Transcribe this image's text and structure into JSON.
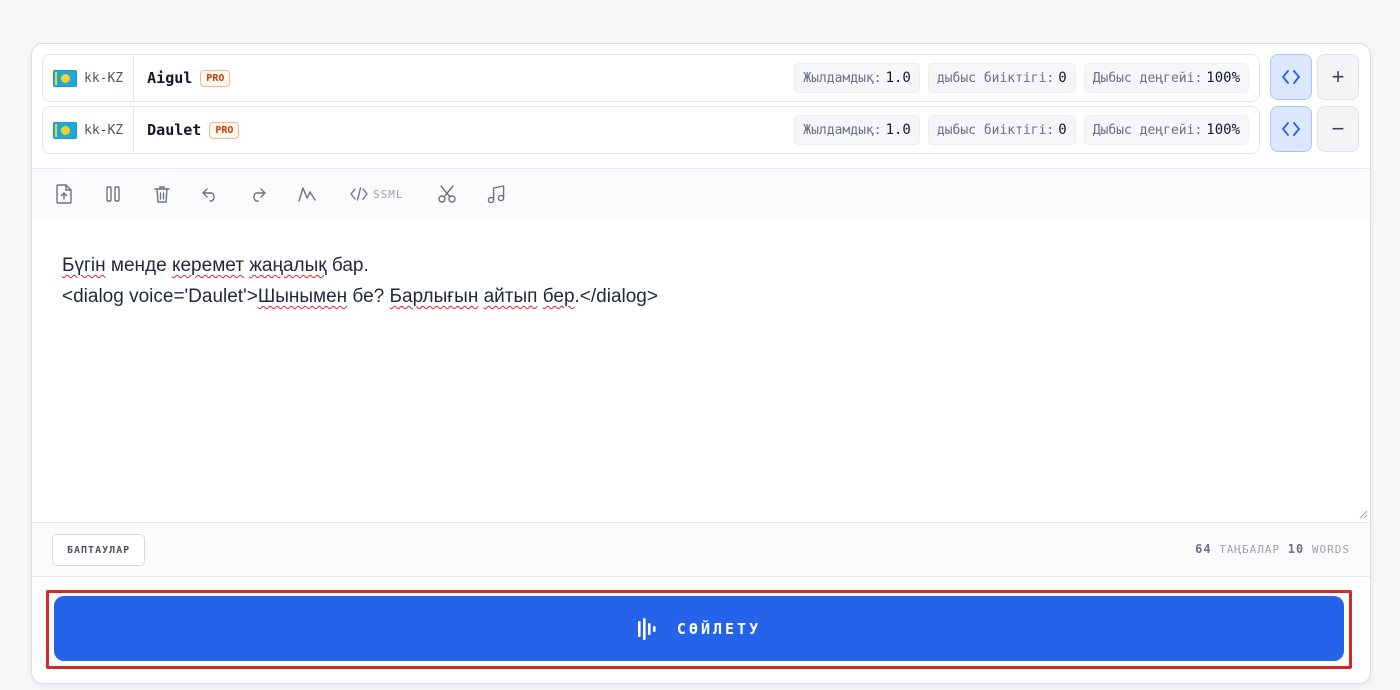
{
  "voices": [
    {
      "lang_code": "kk-KZ",
      "name": "Aigul",
      "badge": "PRO",
      "speed_label": "Жылдамдық:",
      "speed_value": "1.0",
      "pitch_label": "дыбыс биіктігі:",
      "pitch_value": "0",
      "volume_label": "Дыбыс деңгейі:",
      "volume_value": "100%",
      "action_symbol": "+"
    },
    {
      "lang_code": "kk-KZ",
      "name": "Daulet",
      "badge": "PRO",
      "speed_label": "Жылдамдық:",
      "speed_value": "1.0",
      "pitch_label": "дыбыс биіктігі:",
      "pitch_value": "0",
      "volume_label": "Дыбыс деңгейі:",
      "volume_value": "100%",
      "action_symbol": "−"
    }
  ],
  "toolbar": {
    "ssml_label": "SSML",
    "icons": [
      "file-upload-icon",
      "pause-icon",
      "trash-icon",
      "undo-icon",
      "redo-icon",
      "pitch-curve-icon",
      "ssml-code-icon",
      "scissors-icon",
      "music-note-icon"
    ]
  },
  "editor": {
    "line1_parts": [
      "Бүгін",
      " менде ",
      "керемет",
      " ",
      "жаңалық",
      " бар."
    ],
    "line2_parts": [
      "<dialog voice='Daulet'>",
      "Шынымен",
      " бе? ",
      "Барлығын",
      " ",
      "айтып",
      " ",
      "бер",
      ".</dialog>"
    ]
  },
  "footer": {
    "settings_label": "БАПТАУЛАР",
    "char_count": "64",
    "char_label": "ТАҢБАЛАР",
    "word_count": "10",
    "word_label": "WORDS"
  },
  "speak": {
    "label": "СӨЙЛЕТУ",
    "icon": "waveform-icon"
  },
  "colors": {
    "accent": "#2563eb",
    "highlight_border": "#d62828",
    "pro_badge": "#c2410c"
  }
}
